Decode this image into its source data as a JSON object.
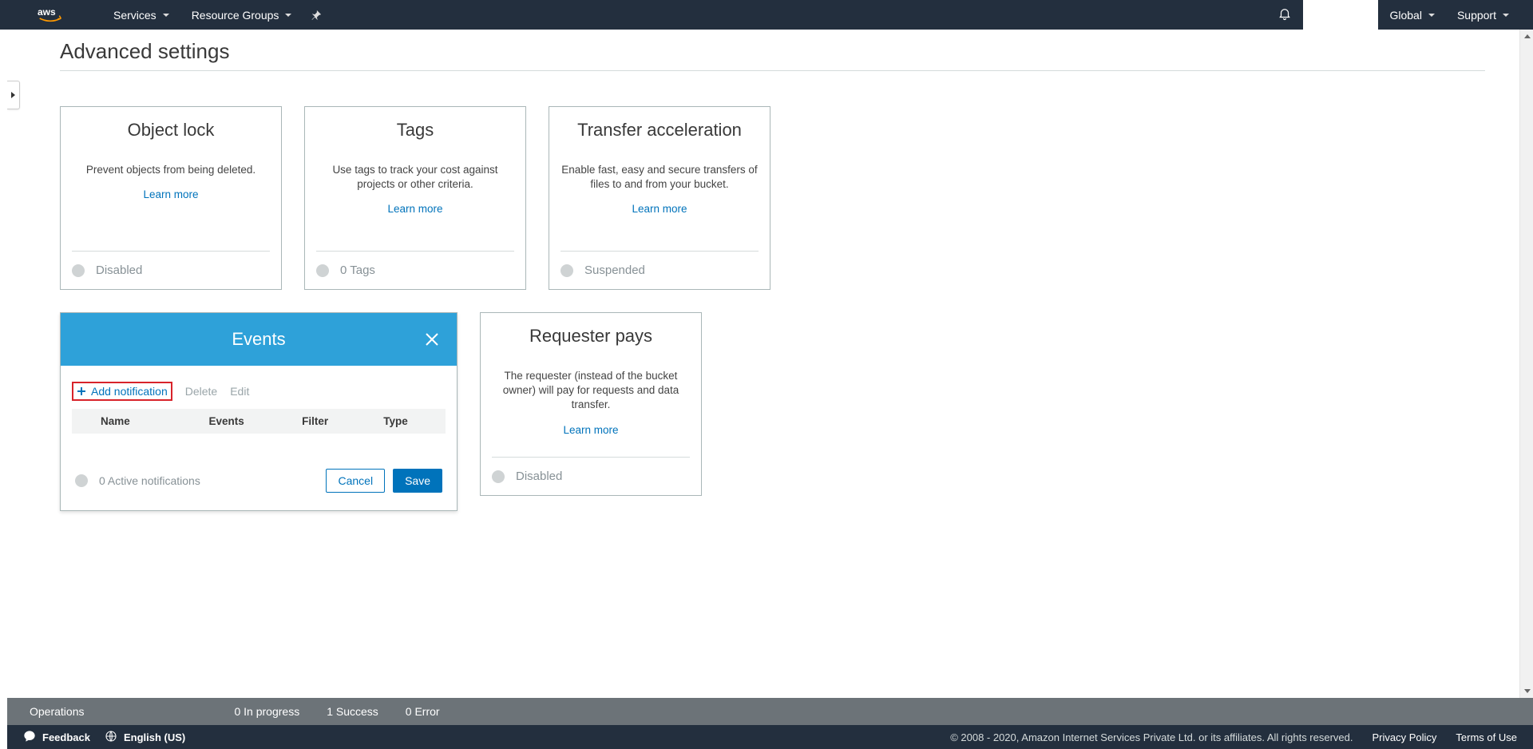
{
  "nav": {
    "services": "Services",
    "resource_groups": "Resource Groups",
    "global": "Global",
    "support": "Support"
  },
  "page": {
    "title": "Advanced settings"
  },
  "cards": {
    "object_lock": {
      "title": "Object lock",
      "desc": "Prevent objects from being deleted.",
      "learn": "Learn more",
      "status": "Disabled"
    },
    "tags": {
      "title": "Tags",
      "desc": "Use tags to track your cost against projects or other criteria.",
      "learn": "Learn more",
      "status": "0 Tags"
    },
    "transfer": {
      "title": "Transfer acceleration",
      "desc": "Enable fast, easy and secure transfers of files to and from your bucket.",
      "learn": "Learn more",
      "status": "Suspended"
    },
    "requester": {
      "title": "Requester pays",
      "desc": "The requester (instead of the bucket owner) will pay for requests and data transfer.",
      "learn": "Learn more",
      "status": "Disabled"
    }
  },
  "events": {
    "title": "Events",
    "add": "Add notification",
    "delete": "Delete",
    "edit": "Edit",
    "columns": {
      "name": "Name",
      "events": "Events",
      "filter": "Filter",
      "type": "Type"
    },
    "status": "0 Active notifications",
    "cancel": "Cancel",
    "save": "Save"
  },
  "ops": {
    "label": "Operations",
    "in_progress": "0 In progress",
    "success": "1 Success",
    "error": "0 Error"
  },
  "footer": {
    "feedback": "Feedback",
    "language": "English (US)",
    "copyright": "© 2008 - 2020, Amazon Internet Services Private Ltd. or its affiliates. All rights reserved.",
    "privacy": "Privacy Policy",
    "terms": "Terms of Use"
  }
}
